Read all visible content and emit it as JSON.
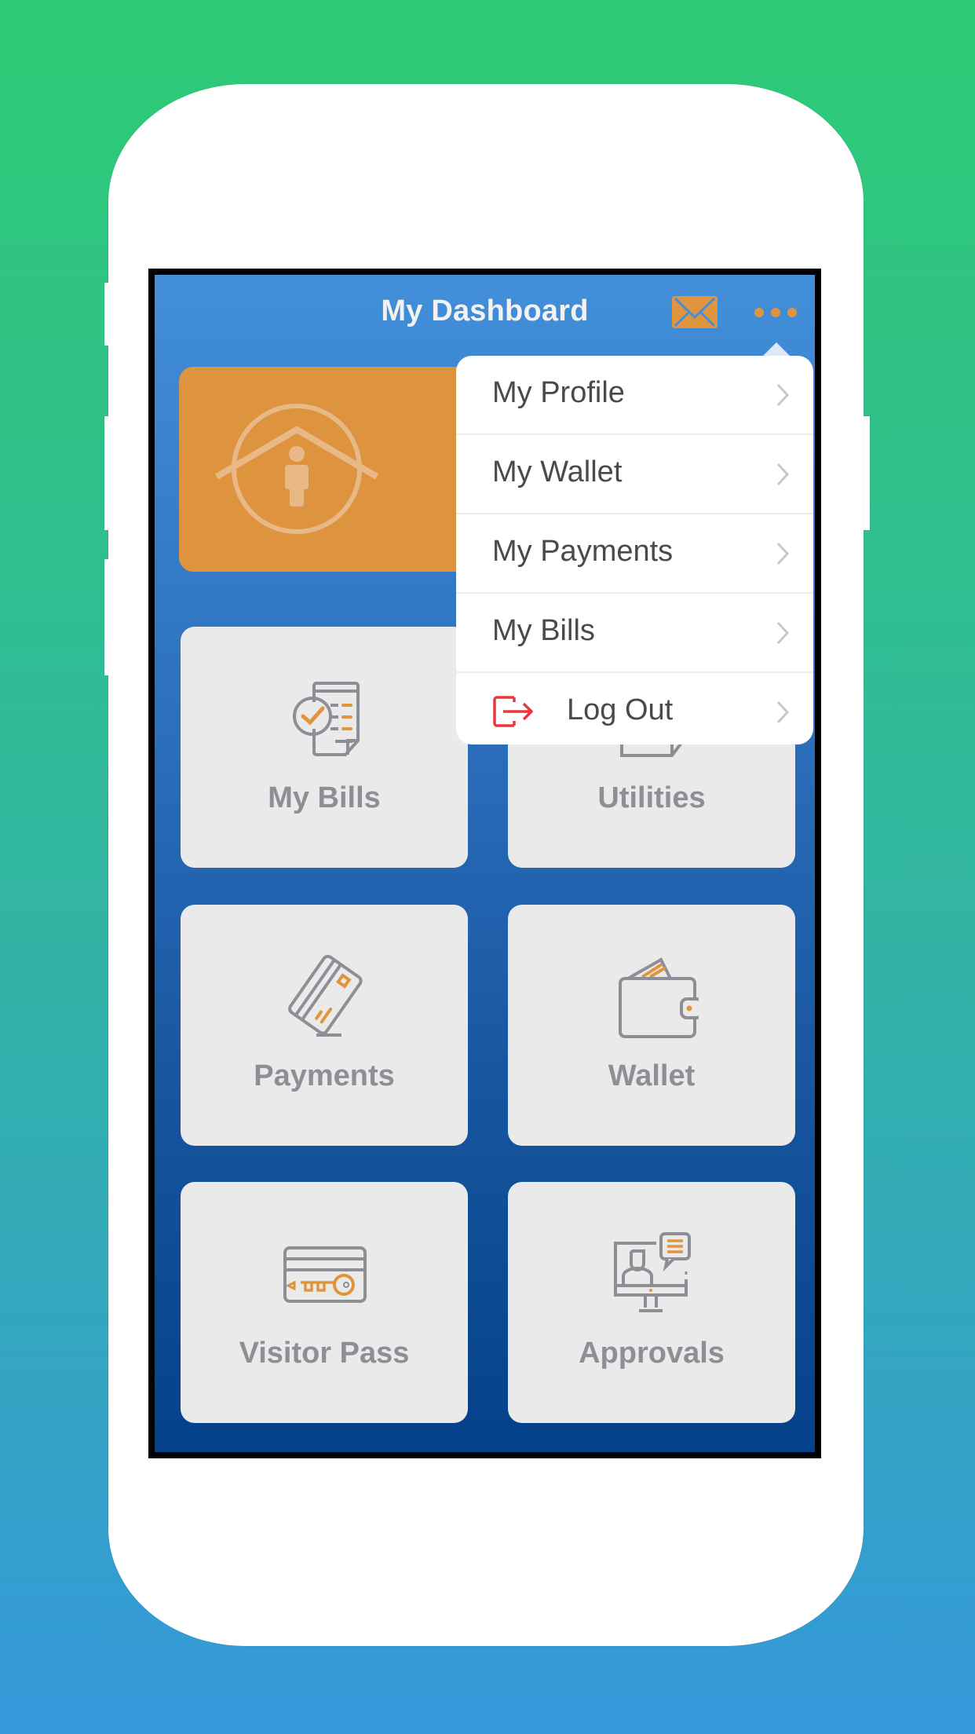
{
  "header": {
    "title": "My Dashboard",
    "mail_icon": "envelope-icon",
    "more_icon": "ellipsis-icon"
  },
  "banner": {
    "icon": "home-person-icon"
  },
  "tiles": [
    {
      "label": "My Bills",
      "icon": "bill-checklist-icon"
    },
    {
      "label": "Utilities",
      "icon": "utilities-icon"
    },
    {
      "label": "Payments",
      "icon": "credit-card-icon"
    },
    {
      "label": "Wallet",
      "icon": "wallet-icon"
    },
    {
      "label": "Visitor Pass",
      "icon": "key-card-icon"
    },
    {
      "label": "Approvals",
      "icon": "computer-chat-icon"
    }
  ],
  "menu": {
    "items": [
      {
        "label": "My Profile",
        "icon": "chevron-right-icon"
      },
      {
        "label": "My Wallet",
        "icon": "chevron-right-icon"
      },
      {
        "label": "My Payments",
        "icon": "chevron-right-icon"
      },
      {
        "label": "My Bills",
        "icon": "chevron-right-icon"
      },
      {
        "label": "Log Out",
        "icon": "logout-icon"
      }
    ]
  },
  "colors": {
    "accent_orange": "#DE943E",
    "tile_background": "#EAEAEA",
    "tile_text": "#8C8F95",
    "screen_top": "#438FD9",
    "screen_bottom": "#04418A",
    "logout_red": "#E8383D",
    "page_bg_top": "#2ECB74",
    "page_bg_bottom": "#3598DB"
  }
}
